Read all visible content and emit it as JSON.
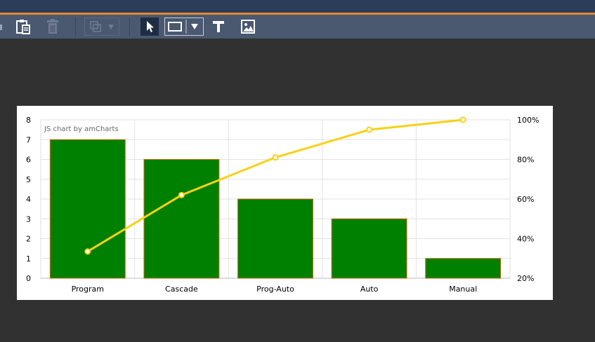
{
  "toolbar": {
    "buttons": [
      {
        "name": "paste-button",
        "icon": "clipboard-icon",
        "enabled": true
      },
      {
        "name": "delete-button",
        "icon": "trash-icon",
        "enabled": false
      },
      {
        "name": "arrange-button",
        "icon": "layers-icon",
        "enabled": false
      },
      {
        "name": "select-tool-button",
        "icon": "cursor-icon",
        "active": true
      },
      {
        "name": "shape-tool-button",
        "icon": "rectangle-icon"
      },
      {
        "name": "text-tool-button",
        "icon": "text-icon",
        "label": "T"
      },
      {
        "name": "image-tool-button",
        "icon": "image-icon"
      }
    ]
  },
  "colors": {
    "titlebar": "#2c3d59",
    "accent": "#e08b2c",
    "toolbar": "#4a5870",
    "canvas": "#313131",
    "bar_fill": "#008000",
    "bar_stroke": "#cc6600",
    "line": "#f7d117"
  },
  "chart": {
    "credit": "JS chart by amCharts"
  },
  "chart_data": {
    "type": "bar",
    "categories": [
      "Program",
      "Cascade",
      "Prog-Auto",
      "Auto",
      "Manual"
    ],
    "series": [
      {
        "type": "bar",
        "values": [
          7,
          6,
          4,
          3,
          1
        ],
        "axis": "left"
      },
      {
        "type": "line",
        "values": [
          33.5,
          62,
          81,
          95,
          100
        ],
        "axis": "right"
      }
    ],
    "y_left": {
      "min": 0,
      "max": 8,
      "ticks": [
        0,
        1,
        2,
        3,
        4,
        5,
        6,
        7,
        8
      ]
    },
    "y_right": {
      "min": 20,
      "max": 100,
      "ticks": [
        "20%",
        "40%",
        "60%",
        "80%",
        "100%"
      ]
    },
    "grid": true
  }
}
